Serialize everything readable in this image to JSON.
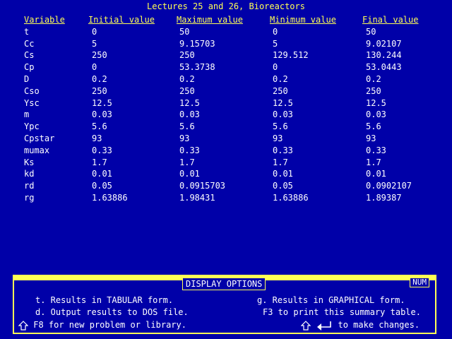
{
  "title": "Lectures 25 and 26, Bioreactors",
  "table": {
    "headers": [
      "Variable",
      "Initial value",
      "Maximum value",
      "Minimum value",
      "Final value"
    ],
    "rows": [
      [
        "t",
        "0",
        "50",
        "0",
        "50"
      ],
      [
        "Cc",
        "5",
        "9.15703",
        "5",
        "9.02107"
      ],
      [
        "Cs",
        "250",
        "250",
        "129.512",
        "130.244"
      ],
      [
        "Cp",
        "0",
        "53.3738",
        "0",
        "53.0443"
      ],
      [
        "D",
        "0.2",
        "0.2",
        "0.2",
        "0.2"
      ],
      [
        "Cso",
        "250",
        "250",
        "250",
        "250"
      ],
      [
        "Ysc",
        "12.5",
        "12.5",
        "12.5",
        "12.5"
      ],
      [
        "m",
        "0.03",
        "0.03",
        "0.03",
        "0.03"
      ],
      [
        "Ypc",
        "5.6",
        "5.6",
        "5.6",
        "5.6"
      ],
      [
        "Cpstar",
        "93",
        "93",
        "93",
        "93"
      ],
      [
        "mumax",
        "0.33",
        "0.33",
        "0.33",
        "0.33"
      ],
      [
        "Ks",
        "1.7",
        "1.7",
        "1.7",
        "1.7"
      ],
      [
        "kd",
        "0.01",
        "0.01",
        "0.01",
        "0.01"
      ],
      [
        "rd",
        "0.05",
        "0.0915703",
        "0.05",
        "0.0902107"
      ],
      [
        "rg",
        "1.63886",
        "1.98431",
        "1.63886",
        "1.89387"
      ]
    ]
  },
  "options": {
    "title": "DISPLAY OPTIONS",
    "num_badge": "NUM",
    "tabular": "t. Results in TABULAR form.",
    "dos_file": "d. Output results to DOS file.",
    "new_problem": "F8 for new problem or library.",
    "graphical": "g. Results in GRAPHICAL form.",
    "print": "F3 to print this summary table.",
    "changes": "to make changes."
  },
  "icons": {
    "shift_left": "shift-up-arrow-icon",
    "shift_right": "shift-up-arrow-icon",
    "enter": "enter-return-icon"
  },
  "colors": {
    "background": "#0000a8",
    "accent": "#ffff55",
    "text": "#ffffff"
  }
}
